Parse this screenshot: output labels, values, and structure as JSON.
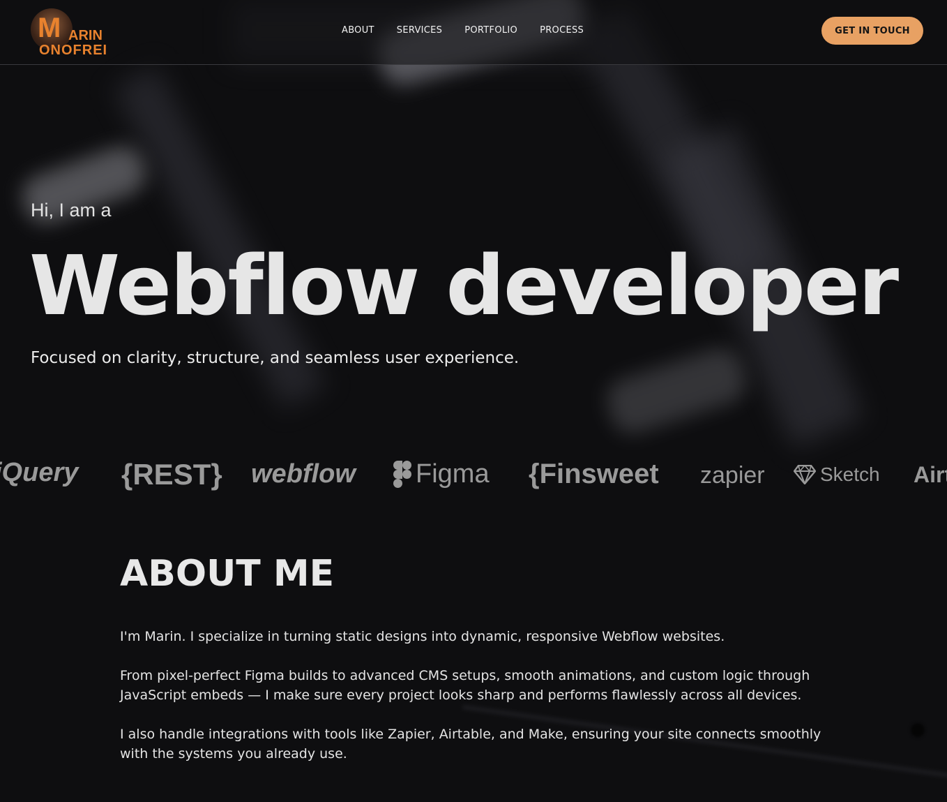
{
  "brand": {
    "logo_letter": "M",
    "name_line1": "ARIN",
    "name_line2": "ONOFREI"
  },
  "nav": {
    "items": [
      {
        "label": "ABOUT"
      },
      {
        "label": "SERVICES"
      },
      {
        "label": "PORTFOLIO"
      },
      {
        "label": "PROCESS"
      }
    ],
    "cta_label": "GET IN TOUCH"
  },
  "hero": {
    "intro": "Hi, I am a",
    "headline": "Webflow developer",
    "tagline": "Focused on clarity, structure, and seamless user experience."
  },
  "tools": {
    "jquery": "jQuery",
    "rest": "{REST}",
    "webflow": "webflow",
    "figma": "Figma",
    "finsweet": "{Finsweet",
    "zapier": "zapier",
    "sketch": "Sketch",
    "airtable": "Airtable"
  },
  "about": {
    "title": "ABOUT ME",
    "paragraphs": [
      "I'm Marin. I specialize in turning static designs into dynamic, responsive Webflow websites.",
      "From pixel-perfect Figma builds to advanced CMS setups, smooth animations, and custom logic through JavaScript embeds — I make sure every project looks sharp and performs flawlessly across all devices.",
      "I also handle integrations with tools like Zapier, Airtable, and Make, ensuring your site connects smoothly with the systems you already use."
    ]
  },
  "colors": {
    "accent": "#e8a163",
    "logo_orange": "#e8822e",
    "background": "#0e0e10"
  }
}
